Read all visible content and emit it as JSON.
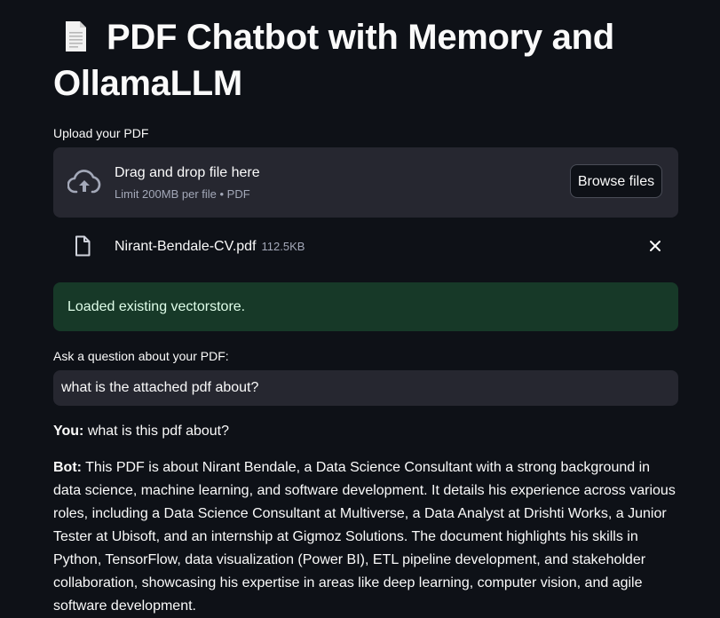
{
  "header": {
    "title": "PDF Chatbot with Memory and OllamaLLM",
    "title_icon": "document-icon"
  },
  "upload": {
    "label": "Upload your PDF",
    "drop_text": "Drag and drop file here",
    "limit_text": "Limit 200MB per file • PDF",
    "browse_label": "Browse files",
    "icon": "cloud-upload-icon"
  },
  "file": {
    "name": "Nirant-Bendale-CV.pdf",
    "size": "112.5KB",
    "icon": "file-icon",
    "remove_icon": "close-icon"
  },
  "status": {
    "message": "Loaded existing vectorstore.",
    "color": "#173928"
  },
  "question": {
    "label": "Ask a question about your PDF:",
    "value": "what is the attached pdf about?"
  },
  "chat": {
    "you_label": "You:",
    "you_text": "what is this pdf about?",
    "bot_label": "Bot:",
    "bot_text": "This PDF is about Nirant Bendale, a Data Science Consultant with a strong background in data science, machine learning, and software development. It details his experience across various roles, including a Data Science Consultant at Multiverse, a Data Analyst at Drishti Works, a Junior Tester at Ubisoft, and an internship at Gigmoz Solutions. The document highlights his skills in Python, TensorFlow, data visualization (Power BI), ETL pipeline development, and stakeholder collaboration, showcasing his expertise in areas like deep learning, computer vision, and agile software development."
  },
  "theme": {
    "background": "#0e1117",
    "panel": "#262730",
    "text": "#fafafa",
    "muted": "#a3a8b8"
  }
}
